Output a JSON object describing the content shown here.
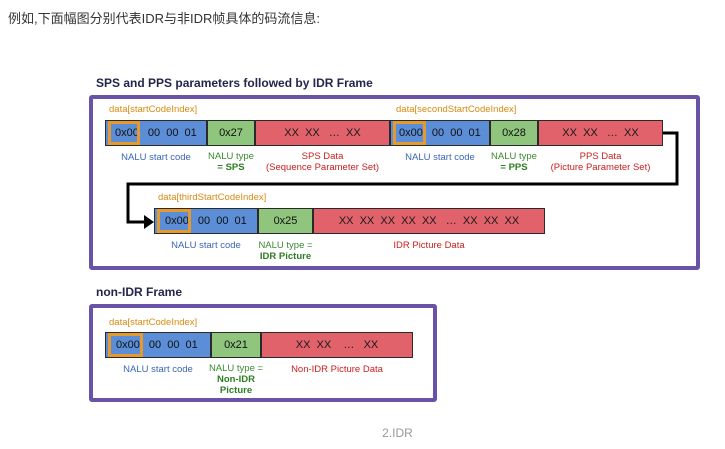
{
  "intro_text": "例如,下面幅图分别代表IDR与非IDR帧具体的码流信息:",
  "idr_section": {
    "title": "SPS and PPS parameters followed by IDR Frame",
    "sps": {
      "index": "data[startCodeIndex]",
      "start_code": {
        "first": "0x00",
        "rest": "00  00  01"
      },
      "nalu_value": "0x27",
      "payload": "XX  XX   …  XX",
      "start_label": "NALU start code",
      "type_label": "NALU type",
      "type_value": "= SPS",
      "data_label_1": "SPS Data",
      "data_label_2": "(Sequence Parameter Set)"
    },
    "pps": {
      "index": "data[secondStartCodeIndex]",
      "start_code": {
        "first": "0x00",
        "rest": "00  00  01"
      },
      "nalu_value": "0x28",
      "payload": "XX  XX   …  XX",
      "start_label": "NALU start code",
      "type_label": "NALU type",
      "type_value": "= PPS",
      "data_label_1": "PPS Data",
      "data_label_2": "(Picture Parameter Set)"
    },
    "idr": {
      "index": "data[thirdStartCodeIndex]",
      "start_code": {
        "first": "0x00",
        "rest": "00  00  01"
      },
      "nalu_value": "0x25",
      "payload": "XX  XX  XX  XX  XX   …  XX  XX  XX",
      "start_label": "NALU start code",
      "type_label": "NALU type =",
      "type_value": "IDR Picture",
      "data_label": "IDR Picture Data"
    }
  },
  "non_idr_section": {
    "title": "non-IDR Frame",
    "index": "data[startCodeIndex]",
    "start_code": {
      "first": "0x00",
      "rest": "00  00  01"
    },
    "nalu_value": "0x21",
    "payload": "XX  XX    …   XX",
    "start_label": "NALU start code",
    "type_label": "NALU type =",
    "type_value_1": "Non-IDR",
    "type_value_2": "Picture",
    "data_label": "Non-IDR Picture Data"
  },
  "caption": "2.IDR",
  "colors": {
    "frame_border": "#6a52a8",
    "start_code": "#5b8ed6",
    "nalu_type": "#8fc57d",
    "payload": "#e1626a",
    "index_highlight": "#e49a2e"
  }
}
